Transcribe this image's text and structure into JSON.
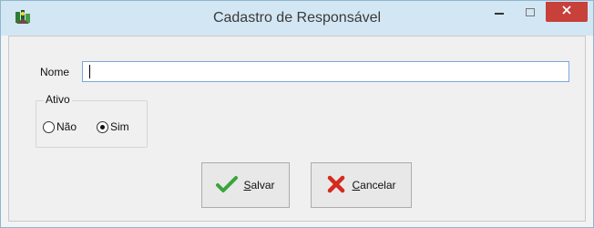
{
  "window": {
    "title": "Cadastro de Responsável",
    "icons": {
      "app": "app-icon",
      "minimize": "minimize-icon",
      "maximize": "maximize-icon",
      "close": "close-icon"
    }
  },
  "form": {
    "name_label": "Nome",
    "name_value": "",
    "active_group": {
      "label": "Ativo",
      "options": [
        "Não",
        "Sim"
      ],
      "selected": "Sim"
    }
  },
  "buttons": {
    "save_label": "Salvar",
    "save_icon": "check-icon",
    "cancel_label": "Cancelar",
    "cancel_icon": "x-icon"
  },
  "colors": {
    "titlebar": "#d3e6f4",
    "close_button": "#c7403a",
    "input_border": "#7aa7d9",
    "check_green": "#3aa53a",
    "x_red": "#d42a1f"
  }
}
